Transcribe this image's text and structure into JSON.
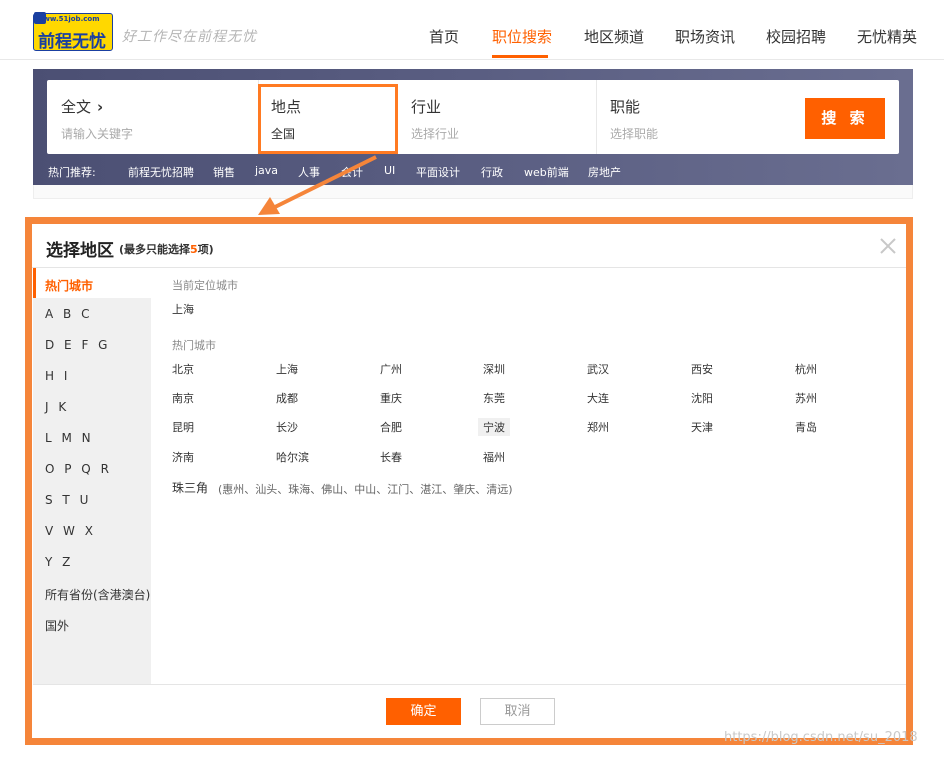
{
  "header": {
    "logo": {
      "url": "www.51job.com",
      "name": "前程无忧"
    },
    "slogan": "好工作尽在前程无忧",
    "nav": [
      {
        "label": "首页",
        "active": false
      },
      {
        "label": "职位搜索",
        "active": true
      },
      {
        "label": "地区频道",
        "active": false
      },
      {
        "label": "职场资讯",
        "active": false
      },
      {
        "label": "校园招聘",
        "active": false
      },
      {
        "label": "无忧精英",
        "active": false
      }
    ]
  },
  "search": {
    "fulltext": {
      "label": "全文",
      "placeholder": "请输入关键字"
    },
    "location": {
      "label": "地点",
      "value": "全国"
    },
    "industry": {
      "label": "行业",
      "placeholder": "选择行业"
    },
    "function": {
      "label": "职能",
      "placeholder": "选择职能"
    },
    "button_label": "搜 索",
    "hot_label": "热门推荐:",
    "hot_tags": [
      "前程无忧招聘",
      "销售",
      "java",
      "人事",
      "会计",
      "UI",
      "平面设计",
      "行政",
      "web前端",
      "房地产"
    ]
  },
  "dialog": {
    "title": "选择地区",
    "limit_prefix": "(最多只能选择",
    "limit_num": "5",
    "limit_suffix": "项)",
    "side_menu": [
      "热门城市",
      "A B C",
      "D E F G",
      "H I",
      "J K",
      "L M N",
      "O P Q R",
      "S T U",
      "V W X",
      "Y Z",
      "所有省份(含港澳台)",
      "国外"
    ],
    "current_city_title": "当前定位城市",
    "current_city": "上海",
    "hot_title": "热门城市",
    "hot_cities": [
      [
        "北京",
        "上海",
        "广州",
        "深圳",
        "武汉",
        "西安",
        "杭州"
      ],
      [
        "南京",
        "成都",
        "重庆",
        "东莞",
        "大连",
        "沈阳",
        "苏州"
      ],
      [
        "昆明",
        "长沙",
        "合肥",
        "宁波",
        "郑州",
        "天津",
        "青岛"
      ],
      [
        "济南",
        "哈尔滨",
        "长春",
        "福州"
      ]
    ],
    "prd_label": "珠三角",
    "prd_cities": "(惠州、汕头、珠海、佛山、中山、江门、湛江、肇庆、清远)",
    "confirm_label": "确定",
    "cancel_label": "取消"
  },
  "watermark": "https://blog.csdn.net/su_2018",
  "colors": {
    "accent": "#ff6000",
    "highlight": "#f5853a",
    "banner": "#555a7e"
  }
}
